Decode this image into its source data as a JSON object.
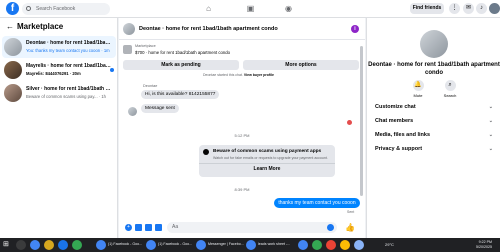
{
  "topbar": {
    "logo": "f",
    "search_placeholder": "Search Facebook",
    "find_friends": "Find friends"
  },
  "sidebar": {
    "title": "Marketplace",
    "back": "←",
    "conversations": [
      {
        "name": "Deontae · home for rent 1bad/1bath...",
        "preview": "You: thanks my team contact you cooon · 1m",
        "active": true
      },
      {
        "name": "Mayrelis · home for rent 1bad/1bath...",
        "preview": "Mayrelis: 8444076291 · 20m",
        "unread": true
      },
      {
        "name": "Silver · home for rent 1bad/1bath a...",
        "preview": "Beware of common scams using pay... · 1h"
      }
    ]
  },
  "chat": {
    "title": "Deontae · home for rent 1bad/1bath apartment condo",
    "listing_label": "Marketplace",
    "listing_text": "$700 · home for rent 1bad/1bath apartment condo",
    "mark_pending": "Mark as pending",
    "more_options": "More options",
    "started_note_prefix": "Deontae started this chat.",
    "started_note_link": "View buyer profile",
    "sender": "Deontae",
    "msg1": "Hi, is this available? 8142155877",
    "msg2": "Message sent",
    "time1": "5:12 PM",
    "card_title": "Beware of common scams using payment apps",
    "card_desc": "Watch out for fake emails or requests to upgrade your payment account.",
    "learn_more": "Learn More",
    "time2": "8:39 PM",
    "msg_out": "thanks my team contact you cooon",
    "sent_label": "Sent",
    "composer_placeholder": "Aa",
    "accent": "#0084ff"
  },
  "right_panel": {
    "name": "Deontae · home for rent 1bad/1bath apartment condo",
    "mute": "Mute",
    "search": "Search",
    "rows": [
      "Customize chat",
      "Chat members",
      "Media, files and links",
      "Privacy & support"
    ]
  },
  "taskbar": {
    "apps": [
      "(1) Facebook - Goo...",
      "(1) Facebook - Goo...",
      "Messenger | Facebo...",
      "leads work sheet -..."
    ],
    "weather": "29°C",
    "time": "9:22 PM",
    "date": "5/20/2025"
  }
}
